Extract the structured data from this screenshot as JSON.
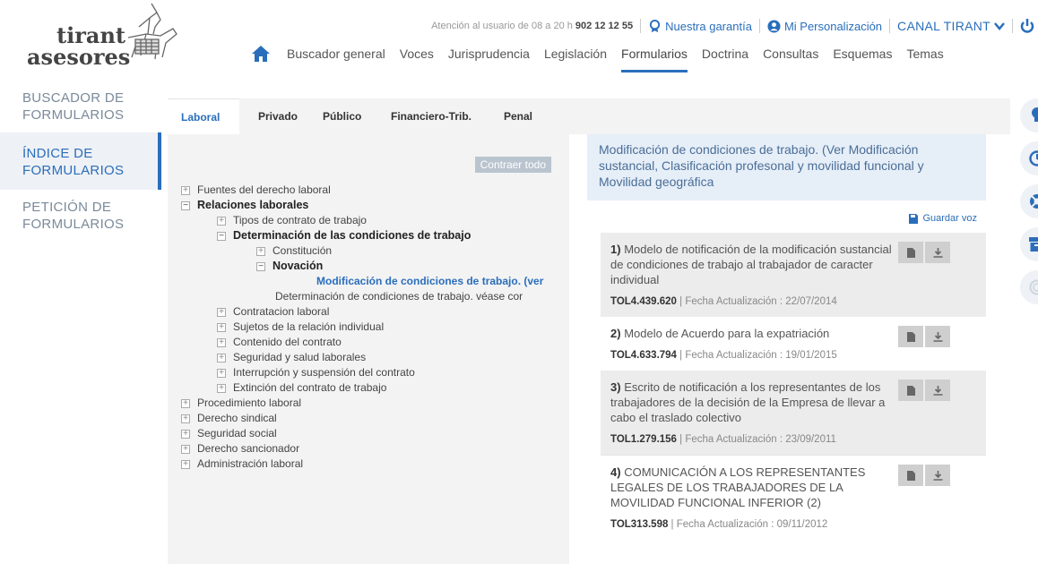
{
  "brand": {
    "line1": "tirant",
    "line2": "asesores"
  },
  "topbar": {
    "support_text": "Atención al usuario de 08 a 20 h",
    "phone": "902 12 12 55",
    "guarantee": "Nuestra garantía",
    "personalization": "Mi Personalización",
    "channel": "CANAL TIRANT"
  },
  "nav": {
    "items": [
      "Buscador general",
      "Voces",
      "Jurisprudencia",
      "Legislación",
      "Formularios",
      "Doctrina",
      "Consultas",
      "Esquemas",
      "Temas"
    ],
    "active": "Formularios"
  },
  "sidebar": {
    "items": [
      {
        "label": "BUSCADOR DE FORMULARIOS"
      },
      {
        "label": "ÍNDICE DE FORMULARIOS"
      },
      {
        "label": "PETICIÓN DE FORMULARIOS"
      }
    ]
  },
  "tabs": [
    "Laboral",
    "Privado",
    "Público",
    "Financiero-Trib.",
    "Penal"
  ],
  "tree": {
    "collapse_label": "Contraer todo",
    "rows": [
      {
        "text": "Fuentes del derecho laboral",
        "box": "+"
      },
      {
        "text": "Relaciones laborales",
        "box": "−"
      },
      {
        "text": "Tipos de contrato de trabajo",
        "box": "+"
      },
      {
        "text": "Determinación de las condiciones de trabajo",
        "box": "−"
      },
      {
        "text": "Constitución",
        "box": "+"
      },
      {
        "text": "Novación",
        "box": "−"
      },
      {
        "text": "Modificación de condiciones de trabajo. (ver",
        "box": ""
      },
      {
        "text": "Determinación de condiciones de trabajo. véase cor",
        "box": ""
      },
      {
        "text": "Contratacion laboral",
        "box": "+"
      },
      {
        "text": "Sujetos de la relación individual",
        "box": "+"
      },
      {
        "text": "Contenido del contrato",
        "box": "+"
      },
      {
        "text": "Seguridad y salud laborales",
        "box": "+"
      },
      {
        "text": "Interrupción y suspensión del contrato",
        "box": "+"
      },
      {
        "text": "Extinción del contrato de trabajo",
        "box": "+"
      },
      {
        "text": "Procedimiento laboral",
        "box": "+"
      },
      {
        "text": "Derecho sindical",
        "box": "+"
      },
      {
        "text": "Seguridad social",
        "box": "+"
      },
      {
        "text": "Derecho sancionador",
        "box": "+"
      },
      {
        "text": "Administración laboral",
        "box": "+"
      }
    ]
  },
  "detail": {
    "heading": "Modificación de condiciones de trabajo. (Ver Modificación sustancial, Clasificación profesonal y movilidad funcional y Movilidad geográfica",
    "save_label": "Guardar voz",
    "docs": [
      {
        "num": "1)",
        "title": "Modelo de notificación de la modificación sustancial de condiciones de trabajo al trabajador de caracter individual",
        "tol": "TOL4.439.620",
        "date_label": "Fecha Actualización : 22/07/2014"
      },
      {
        "num": "2)",
        "title": "Modelo de Acuerdo para la expatriación",
        "tol": "TOL4.633.794",
        "date_label": "Fecha Actualización : 19/01/2015"
      },
      {
        "num": "3)",
        "title": "Escrito de notificación a los representantes de los trabajadores de la decisión de la Empresa de llevar a cabo el traslado colectivo",
        "tol": "TOL1.279.156",
        "date_label": "Fecha Actualización : 23/09/2011"
      },
      {
        "num": "4)",
        "title": "COMUNICACIÓN A LOS REPRESENTANTES LEGALES DE LOS TRABAJADORES DE LA MOVILIDAD FUNCIONAL INFERIOR (2)",
        "tol": "TOL313.598",
        "date_label": "Fecha Actualización : 09/11/2012"
      }
    ]
  }
}
